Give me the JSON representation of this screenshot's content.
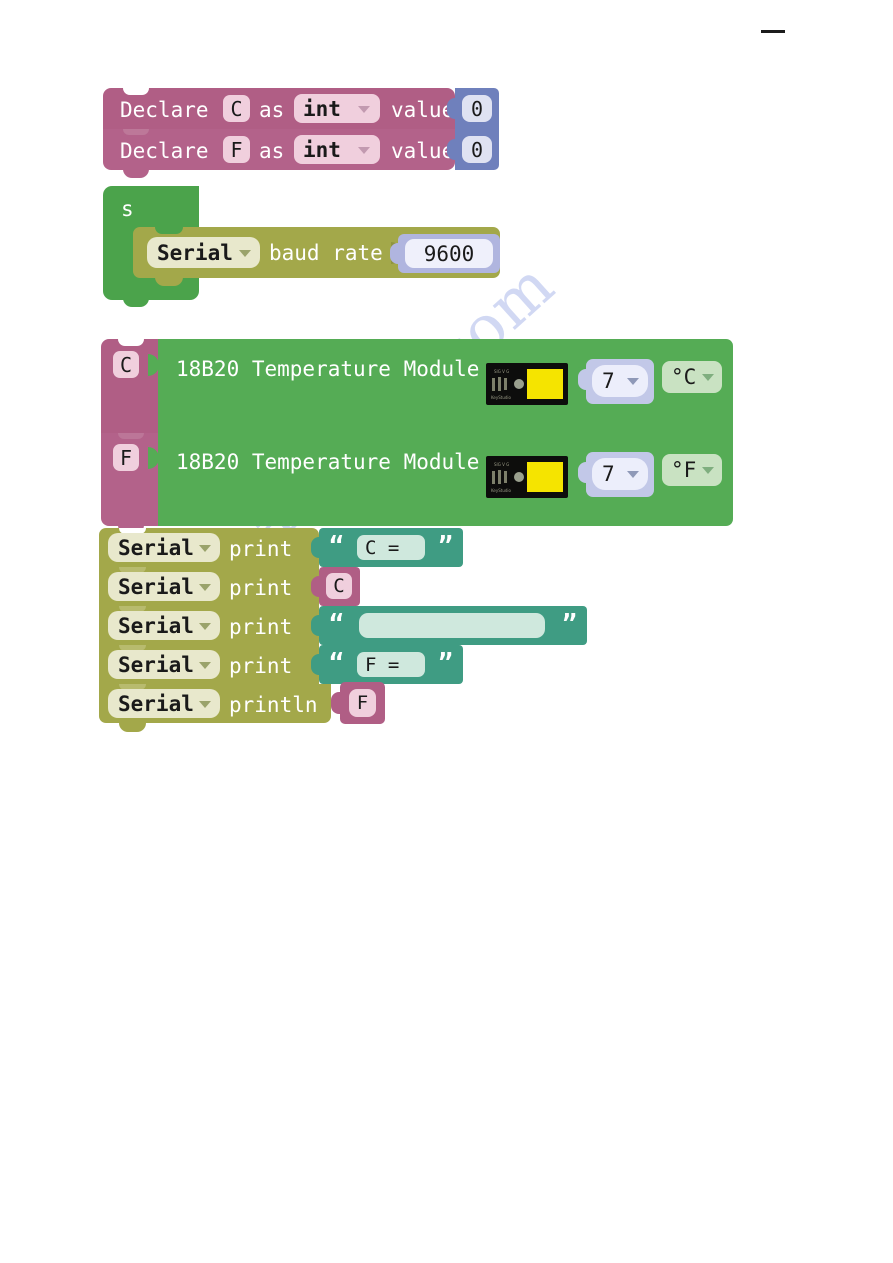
{
  "page": {
    "watermark": "manualshive.com",
    "top_rule": "horizontal-rule"
  },
  "blocks": {
    "declare": [
      {
        "keyword": "Declare",
        "variable": "C",
        "as_label": "as",
        "type": "int",
        "value_label": "value",
        "value": "0"
      },
      {
        "keyword": "Declare",
        "variable": "F",
        "as_label": "as",
        "type": "int",
        "value_label": "value",
        "value": "0"
      }
    ],
    "setup": {
      "title": "setup",
      "serial_port": "Serial",
      "baud_label": "baud rate",
      "baud_value": "9600"
    },
    "sensors": [
      {
        "variable": "C",
        "name": "18B20 Temperature Module",
        "pin": "7",
        "unit": "°C",
        "icon": "ds18b20-module-photo"
      },
      {
        "variable": "F",
        "name": "18B20 Temperature Module",
        "pin": "7",
        "unit": "°F",
        "icon": "ds18b20-module-photo"
      }
    ],
    "serial_prints": [
      {
        "port": "Serial",
        "method": "print",
        "arg_kind": "string",
        "arg": "C = "
      },
      {
        "port": "Serial",
        "method": "print",
        "arg_kind": "variable",
        "arg": "C"
      },
      {
        "port": "Serial",
        "method": "print",
        "arg_kind": "string",
        "arg": "    "
      },
      {
        "port": "Serial",
        "method": "print",
        "arg_kind": "string",
        "arg": "F = "
      },
      {
        "port": "Serial",
        "method": "println",
        "arg_kind": "variable",
        "arg": "F"
      }
    ]
  },
  "colors": {
    "variable_block": "#b05e85",
    "number_block": "#6f80bc",
    "setup_block": "#4ba34b",
    "serial_block": "#a3a84a",
    "sensor_block": "#55ac55",
    "string_block": "#3f9c83",
    "watermark": "#c9d2f2"
  }
}
